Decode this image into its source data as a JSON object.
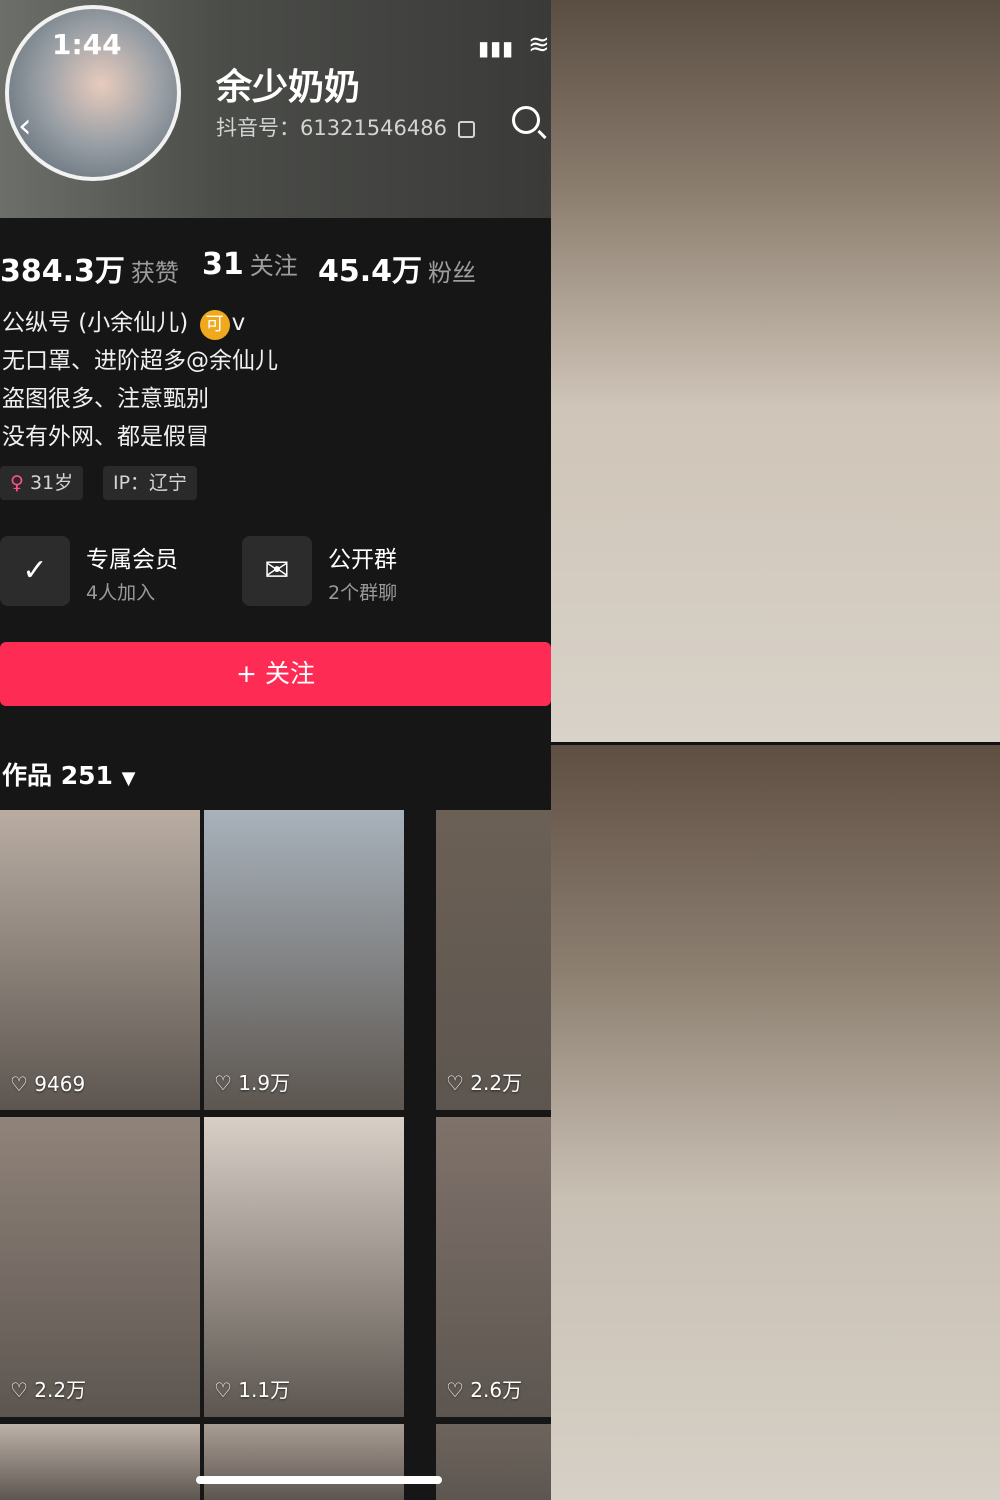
{
  "status": {
    "time": "1:44",
    "signal_icon": "signal-bars-icon",
    "wifi_icon": "wifi-icon"
  },
  "profile": {
    "name": "余少奶奶",
    "douyin_id": "抖音号：61321546486",
    "avatar_icon": "avatar-photo"
  },
  "stats": [
    {
      "value": "384.3万",
      "label": "获赞"
    },
    {
      "value": "31",
      "label": "关注"
    },
    {
      "value": "45.4万",
      "label": "粉丝"
    }
  ],
  "bio": [
    "公纵号 (小余仙儿)",
    "无口罩、进阶超多@余仙儿",
    "盗图很多、注意甄别",
    "没有外网、都是假冒"
  ],
  "bio_badge": "可",
  "bio_v": "v",
  "tags": [
    {
      "text": "31岁"
    },
    {
      "text": "IP：辽宁"
    }
  ],
  "features": [
    {
      "title": "专属会员",
      "subtitle": "4人加入",
      "icon": "v-badge-icon"
    },
    {
      "title": "公开群",
      "subtitle": "2个群聊",
      "icon": "chat-bubbles-icon"
    }
  ],
  "follow_button": "+ 关注",
  "works_label": "作品 251",
  "grid": [
    {
      "likes": "9469",
      "color": "#b9ada3"
    },
    {
      "likes": "1.9万",
      "color": "#a8b2bb"
    },
    {
      "likes": "2.2万",
      "color": "#6b6055"
    },
    {
      "likes": "2.2万",
      "color": "#90837a"
    },
    {
      "likes": "1.1万",
      "color": "#d8cfc7"
    },
    {
      "likes": "2.6万",
      "color": "#7f726b"
    },
    {
      "likes": "",
      "color": "#bdb1a8"
    },
    {
      "likes": "",
      "color": "#a89c93"
    },
    {
      "likes": "",
      "color": "#6d645d"
    }
  ]
}
